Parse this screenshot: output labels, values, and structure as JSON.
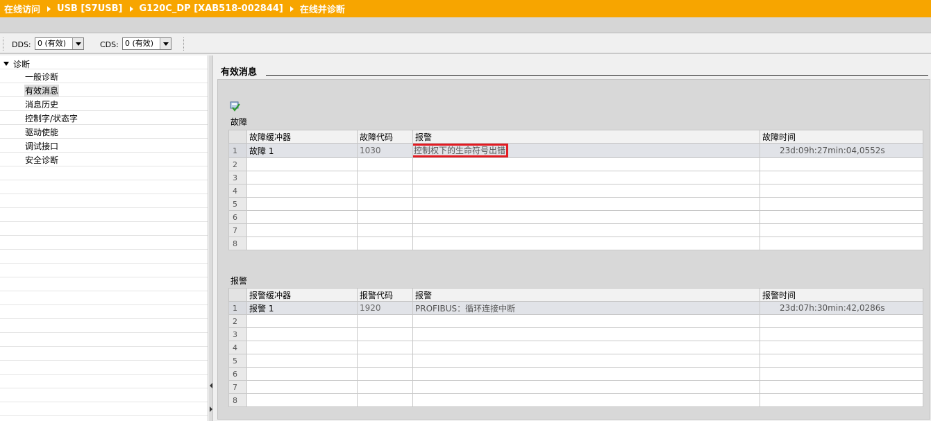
{
  "breadcrumb": [
    "在线访问",
    "USB [S7USB]",
    "G120C_DP [XAB518-002844]",
    "在线并诊断"
  ],
  "toolbar": {
    "dds_label": "DDS:",
    "dds_value": "0 (有效)",
    "cds_label": "CDS:",
    "cds_value": "0 (有效)"
  },
  "sidebar": {
    "root": "诊断",
    "items": [
      "一般诊断",
      "有效消息",
      "消息历史",
      "控制字/状态字",
      "驱动使能",
      "调试接口",
      "安全诊断"
    ],
    "selected_index": 1
  },
  "main": {
    "title": "有效消息",
    "faults": {
      "label": "故障",
      "columns": [
        "故障缓冲器",
        "故障代码",
        "报警",
        "故障时间"
      ],
      "row_numbers": [
        "1",
        "2",
        "3",
        "4",
        "5",
        "6",
        "7",
        "8"
      ],
      "rows": [
        {
          "buffer": "故障 1",
          "code": "1030",
          "message": "控制权下的生命符号出错",
          "time": "23d:09h:27min:04,0552s"
        }
      ]
    },
    "alarms": {
      "label": "报警",
      "columns": [
        "报警缓冲器",
        "报警代码",
        "报警",
        "报警时间"
      ],
      "row_numbers": [
        "1",
        "2",
        "3",
        "4",
        "5",
        "6",
        "7",
        "8"
      ],
      "rows": [
        {
          "buffer": "报警 1",
          "code": "1920",
          "message": "PROFIBUS：循环连接中断",
          "time": "23d:07h:30min:42,0286s"
        }
      ]
    }
  },
  "colors": {
    "titlebar": "#f7a500",
    "highlight": "#e21c23"
  },
  "icons": {
    "acknowledge": "acknowledge-icon"
  }
}
